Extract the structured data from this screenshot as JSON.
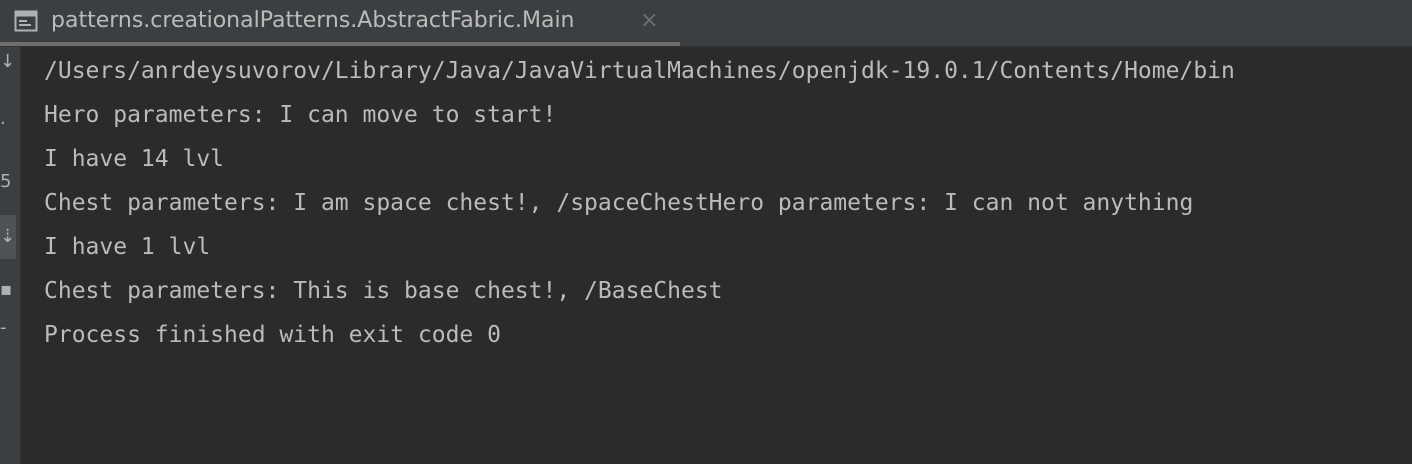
{
  "tab": {
    "title": "patterns.creationalPatterns.AbstractFabric.Main",
    "close_glyph": "×",
    "icon": "console-window-icon"
  },
  "gutter": {
    "buttons": [
      {
        "icon": "rerun-icon",
        "glyph": "↓"
      },
      {
        "icon": "stop-icon",
        "glyph": "·"
      },
      {
        "icon": "soft-wrap-icon",
        "glyph": "5"
      },
      {
        "icon": "scroll-to-end-icon",
        "glyph": "⇣"
      },
      {
        "icon": "print-icon",
        "glyph": "▪"
      },
      {
        "icon": "trash-icon",
        "glyph": "-"
      }
    ]
  },
  "console": {
    "lines": [
      "/Users/anrdeysuvorov/Library/Java/JavaVirtualMachines/openjdk-19.0.1/Contents/Home/bin",
      "Hero parameters: I can move to start!",
      "I have 14 lvl",
      "Chest parameters: I am space chest!, /spaceChestHero parameters: I can not anything",
      "I have 1 lvl",
      "Chest parameters: This is base chest!, /BaseChest",
      "Process finished with exit code 0"
    ]
  },
  "colors": {
    "background": "#2b2b2b",
    "text": "#bbbbbb",
    "tabbar": "#3c3f41"
  }
}
